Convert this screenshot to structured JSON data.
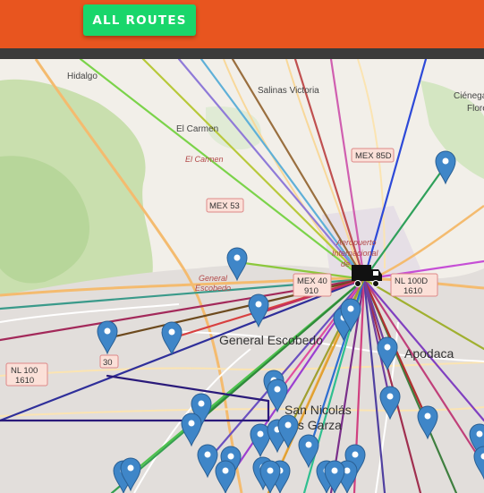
{
  "header": {
    "all_routes_label": "ALL ROUTES"
  },
  "colors": {
    "topbar": "#e8551f",
    "button": "#19d66b",
    "pin": "#3f86c8"
  },
  "map": {
    "places": [
      {
        "text": "Hidalgo"
      },
      {
        "text": "Salinas Victoria"
      },
      {
        "text": "Ciénega de"
      },
      {
        "text": "Flores"
      },
      {
        "text": "El Carmen"
      },
      {
        "text": "El Carmen"
      },
      {
        "text": "General"
      },
      {
        "text": "Escobedo"
      },
      {
        "text": "General Escobedo"
      },
      {
        "text": "San Nicolás"
      },
      {
        "text": "los Garza"
      },
      {
        "text": "Apodaca"
      },
      {
        "text": "Aeropuerto"
      },
      {
        "text": "Internacional"
      },
      {
        "text": "de"
      }
    ],
    "shields": [
      {
        "lines": [
          "MEX 85D"
        ]
      },
      {
        "lines": [
          "MEX 53"
        ]
      },
      {
        "lines": [
          "MEX 40",
          "910"
        ]
      },
      {
        "lines": [
          "NL 100D",
          "1610"
        ]
      },
      {
        "lines": [
          "NL 100",
          "1610"
        ]
      },
      {
        "lines": [
          "30"
        ]
      }
    ],
    "hub_icon": "truck-icon",
    "pin_icon": "map-pin-icon"
  }
}
